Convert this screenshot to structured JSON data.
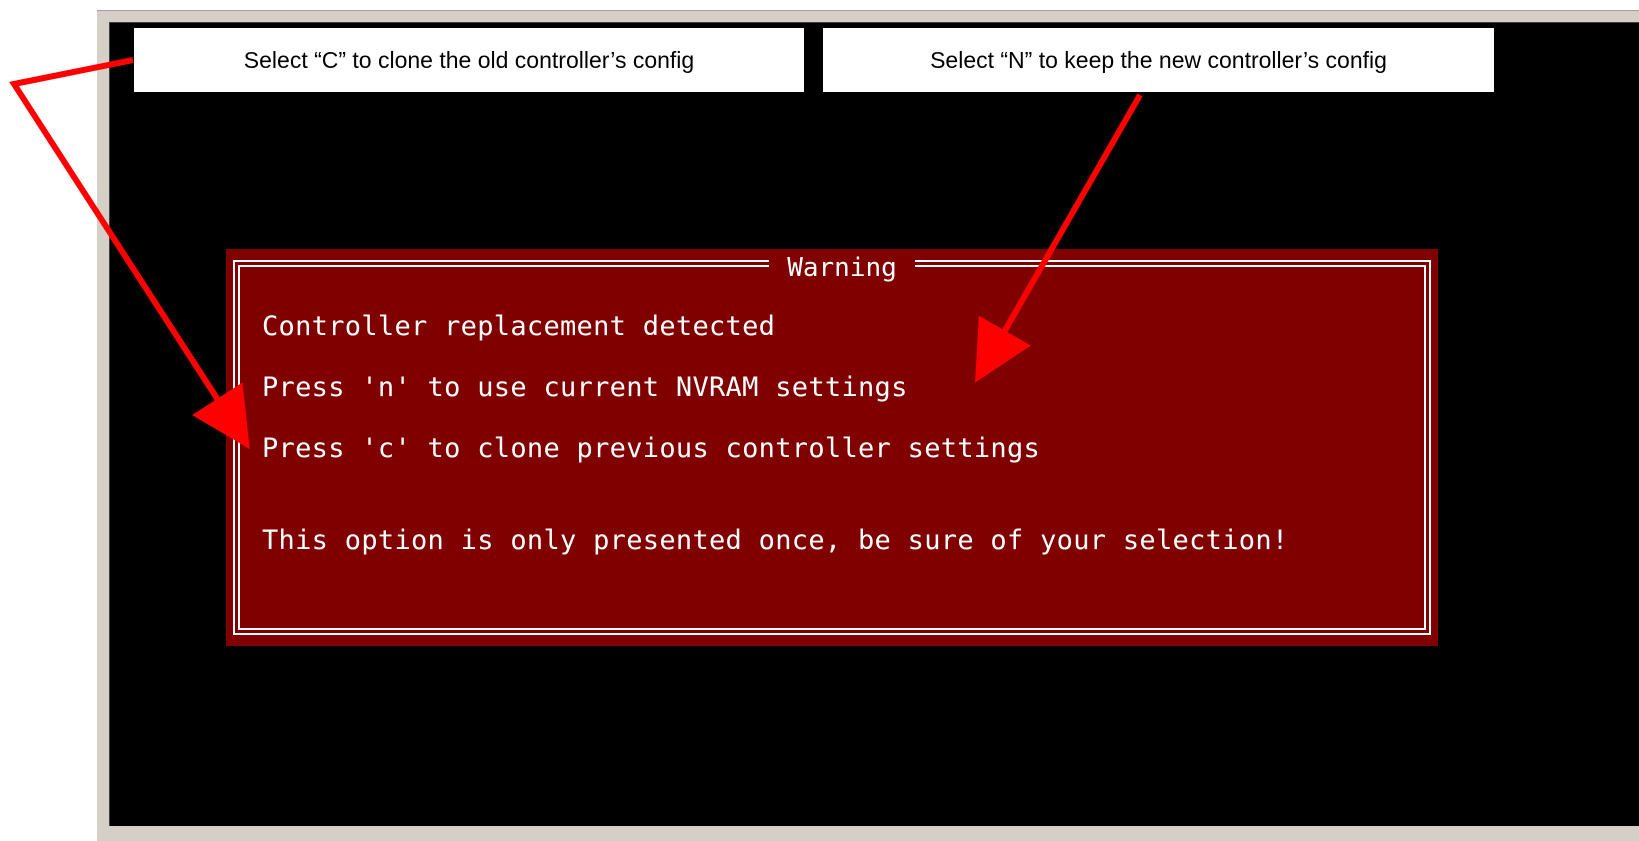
{
  "callouts": {
    "clone": "Select “C” to clone the old controller’s config",
    "keep": "Select “N” to keep the new controller’s config"
  },
  "warning": {
    "title": "Warning",
    "lines": [
      "Controller replacement detected",
      "Press 'n' to use current NVRAM settings",
      "Press 'c' to clone previous controller settings",
      "This option is only presented once, be sure of your selection!"
    ]
  },
  "colors": {
    "dialog_background": "#800000",
    "console_background": "#000000",
    "arrow": "#ff0000",
    "frame": "#d4d0c8"
  }
}
